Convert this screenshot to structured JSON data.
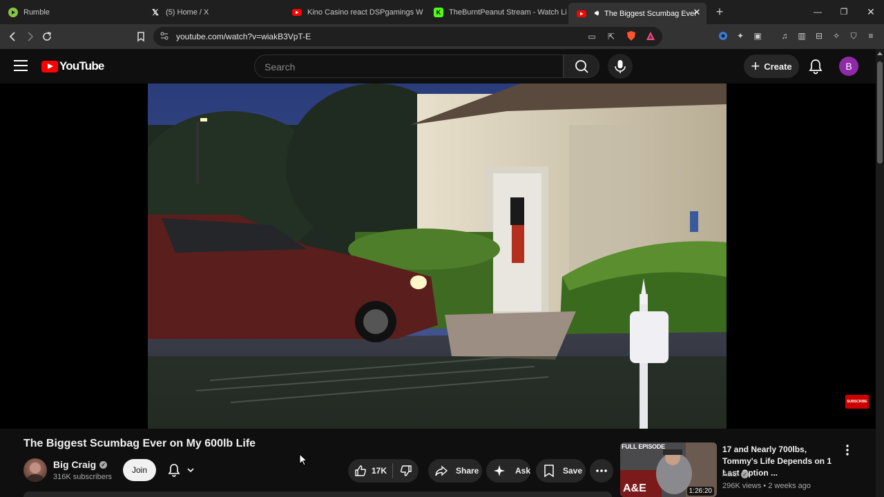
{
  "browser": {
    "tabs": [
      {
        "label": "Rumble",
        "icon": "rumble-icon",
        "active": false
      },
      {
        "label": "(5) Home / X",
        "icon": "x-icon",
        "active": false
      },
      {
        "label": "Kino Casino react DSPgamings W",
        "icon": "youtube-icon",
        "active": false
      },
      {
        "label": "TheBurntPeanut Stream - Watch Live",
        "icon": "kick-icon",
        "active": false
      },
      {
        "label": "The Biggest Scumbag Ever on",
        "icon": "youtube-icon",
        "active": true
      }
    ],
    "url": "youtube.com/watch?v=wiakB3VpT-E"
  },
  "header": {
    "logo_text": "YouTube",
    "search_placeholder": "Search",
    "create_label": "Create",
    "avatar_letter": "B"
  },
  "player": {
    "watermark_text": "SUBSCRIBE"
  },
  "video": {
    "title": "The Biggest Scumbag Ever on My 600lb Life",
    "channel": {
      "name": "Big Craig",
      "subscribers": "316K subscribers",
      "join_label": "Join"
    },
    "actions": {
      "likes": "17K",
      "share_label": "Share",
      "ask_label": "Ask",
      "save_label": "Save"
    }
  },
  "recommended": [
    {
      "title": "17 and Nearly 700lbs, Tommy's Life Depends on 1 Last Option ...",
      "channel": "A&E",
      "meta": "296K views • 2 weeks ago",
      "duration": "1:26:20",
      "badge": "FULL EPISODE",
      "logo": "A&E"
    }
  ],
  "colors": {
    "brand_red": "#ff0000",
    "avatar_purple": "#8e2aa8",
    "background": "#0f0f0f"
  }
}
